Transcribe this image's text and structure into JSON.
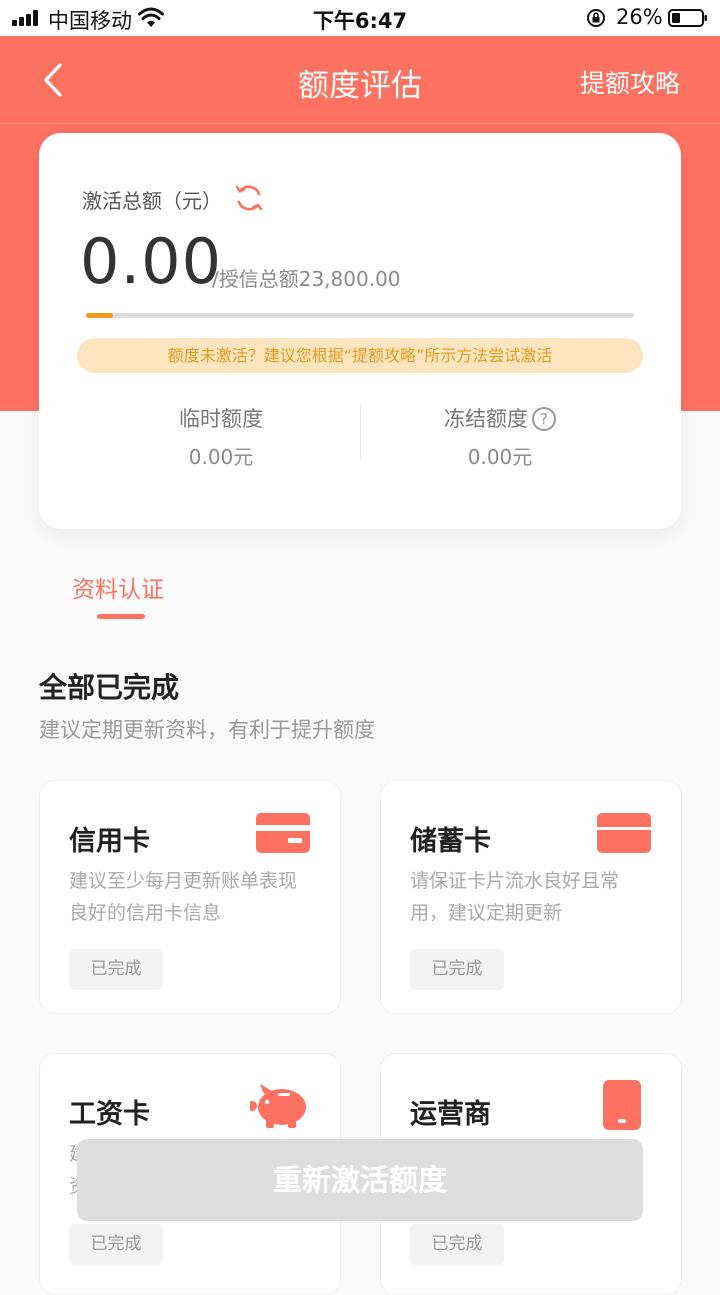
{
  "status_bar": {
    "carrier": "中国移动",
    "time": "下午6:47",
    "battery": "26%"
  },
  "nav": {
    "title": "额度评估",
    "right_link": "提额攻略"
  },
  "summary": {
    "label": "激活总额（元）",
    "amount": "0.00",
    "total_credit": "/授信总额23,800.00",
    "progress_fraction": 0.05,
    "tip": "额度未激活？建议您根据“提额攻略”所示方法尝试激活",
    "temp_label": "临时额度",
    "temp_value": "0.00元",
    "frozen_label": "冻结额度",
    "frozen_value": "0.00元"
  },
  "tabs": {
    "active": "资料认证"
  },
  "section": {
    "title": "全部已完成",
    "subtitle": "建议定期更新资料，有利于提升额度"
  },
  "items": [
    {
      "name": "信用卡",
      "desc": "建议至少每月更新账单表现良好的信用卡信息",
      "status": "已完成",
      "icon": "credit-card-icon"
    },
    {
      "name": "储蓄卡",
      "desc": "请保证卡片流水良好且常用，建议定期更新",
      "status": "已完成",
      "icon": "debit-card-icon"
    },
    {
      "name": "工资卡",
      "desc": "建资",
      "status": "已完成",
      "icon": "piggy-bank-icon"
    },
    {
      "name": "运营商",
      "desc": "",
      "status": "已完成",
      "icon": "phone-icon"
    }
  ],
  "button": {
    "label": "重新激活额度"
  },
  "colors": {
    "brand": "#fd7161",
    "progress": "#f29a1f",
    "tip_bg": "#fde5c0",
    "tip_text": "#e39a1e"
  }
}
